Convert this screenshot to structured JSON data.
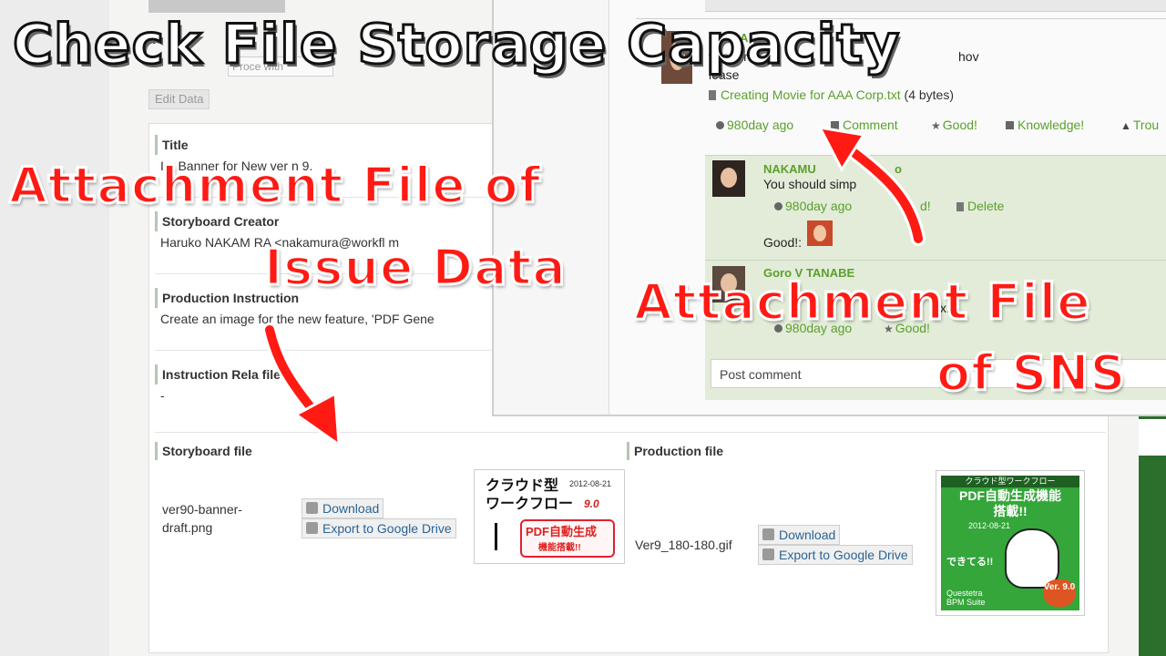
{
  "overlay": {
    "title": "Check File Storage Capacity",
    "issue_caption_line1": "Attachment File of",
    "issue_caption_line2": "Issue Data",
    "sns_caption_line1": "Attachment File",
    "sns_caption_line2": "of SNS"
  },
  "issue_page": {
    "fragment_heading": "a",
    "fragment_button": "Proce with",
    "edit_data_label": "Edit Data",
    "fields": [
      {
        "label": "Title",
        "value": "Im   Banner for New ver  n 9."
      },
      {
        "label": "Storyboard Creator",
        "value": "Haruko NAKAM  RA <nakamura@workfl   m"
      },
      {
        "label": "Production Instruction",
        "value": "Create an image for the new feature, 'PDF Gene"
      },
      {
        "label": "Instruction Rela    file",
        "value": "-"
      }
    ],
    "storyboard_file": {
      "label": "Storyboard file",
      "filename": "ver90-banner-draft.png",
      "download_label": "Download",
      "export_label": "Export to Google Drive",
      "thumbnail": {
        "line1": "クラウド型",
        "line2": "ワークフロー",
        "date": "2012-08-21",
        "version": "9.0",
        "pdf": "PDF自動生成",
        "pdf_sub": "機能搭載!!"
      }
    },
    "production_file": {
      "label": "Production file",
      "filename": "Ver9_180-180.gif",
      "download_label": "Download",
      "export_label": "Export to Google Drive",
      "thumbnail": {
        "header": "クラウド型ワークフロー",
        "title_line1": "PDF自動生成機能",
        "title_line2": "搭載!!",
        "date": "2012-08-21",
        "done": "できてる!!",
        "brand_line1": "Questetra",
        "brand_line2": "BPM Suite",
        "version": "Ver. 9.0"
      }
    }
  },
  "sns": {
    "post": {
      "author": "Goro   A  N",
      "text_line1": "wro   a r",
      "text_line2": "lease",
      "right_fragment": "hov",
      "attachment_name": "Creating Movie for AAA Corp.txt",
      "attachment_size": "(4 bytes)",
      "time": "980day ago",
      "comment_label": "Comment",
      "good_label": "Good!",
      "knowledge_label": "Knowledge!",
      "trouble_label": "Trou"
    },
    "reply1": {
      "author": "NAKAMU",
      "author_suffix": "o",
      "text": "You should simp",
      "time": "980day ago",
      "good_label": "d!",
      "delete_label": "Delete",
      "good_by": "Good!:"
    },
    "reply2": {
      "author": "Goro V   TANABE",
      "text_fragment": "x.",
      "time": "980day ago",
      "good_label": "Good!"
    },
    "post_comment_placeholder": "Post comment"
  }
}
